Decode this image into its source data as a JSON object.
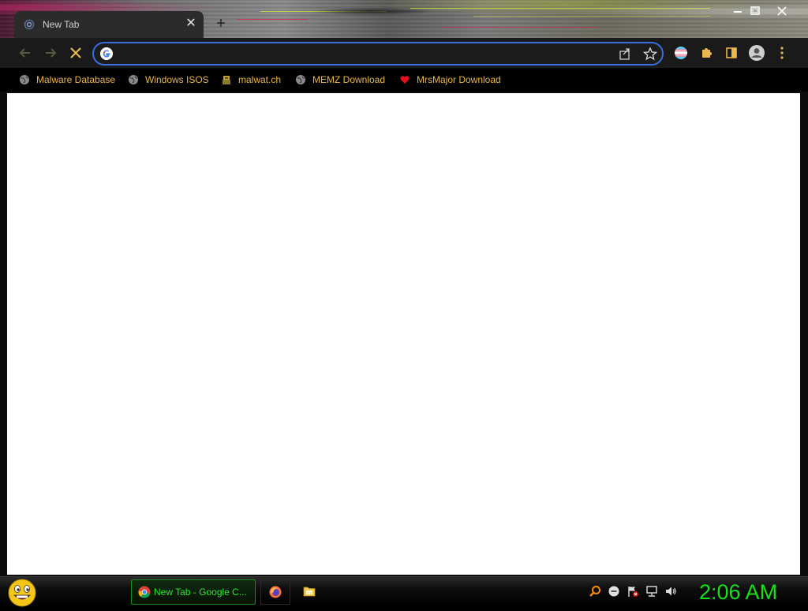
{
  "browser": {
    "tab": {
      "title": "New Tab"
    },
    "omnibox": {
      "value": ""
    }
  },
  "bookmarks": [
    {
      "label": "Malware Database",
      "icon": "globe-icon"
    },
    {
      "label": "Windows ISOS",
      "icon": "globe-icon"
    },
    {
      "label": "malwat.ch",
      "icon": "malwatch-icon"
    },
    {
      "label": "MEMZ Download",
      "icon": "globe-icon"
    },
    {
      "label": "MrsMajor Download",
      "icon": "heart-icon"
    }
  ],
  "taskbar": {
    "tasks": [
      {
        "label": "New Tab - Google C...",
        "icon": "chrome-icon"
      },
      {
        "label": "",
        "icon": "firefox-icon"
      },
      {
        "label": "",
        "icon": "folder-icon"
      }
    ],
    "clock": "2:06 AM"
  },
  "colors": {
    "accent": "#3b6de0",
    "bookmark_text": "#e8b84a",
    "clock": "#18e018",
    "task_text": "#2ee62e"
  }
}
